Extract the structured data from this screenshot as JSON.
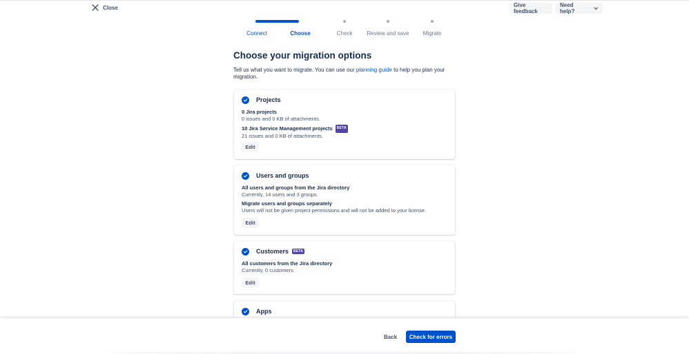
{
  "header": {
    "close_label": "Close",
    "give_feedback_label": "Give feedback",
    "need_help_label": "Need help?"
  },
  "stepper": {
    "steps": [
      {
        "label": "Connect",
        "state": "complete"
      },
      {
        "label": "Choose",
        "state": "current"
      },
      {
        "label": "Check",
        "state": "upcoming"
      },
      {
        "label": "Review and save",
        "state": "upcoming"
      },
      {
        "label": "Migrate",
        "state": "upcoming"
      }
    ]
  },
  "main": {
    "heading": "Choose your migration options",
    "intro_before": "Tell us what you want to migrate. You can use our ",
    "intro_link": "planning guide",
    "intro_after": " to help you plan your migration."
  },
  "cards": {
    "projects": {
      "title": "Projects",
      "items": [
        {
          "title": "0 Jira projects",
          "desc": "0 issues and 0 KB of attachments."
        },
        {
          "title": "10 Jira Service Management projects",
          "badge": "BETA",
          "desc": "21 issues and 0 KB of attachments."
        }
      ],
      "edit_label": "Edit"
    },
    "users": {
      "title": "Users and groups",
      "items": [
        {
          "title": "All users and groups from the Jira directory",
          "desc": "Currently, 14 users and 3 groups."
        },
        {
          "title": "Migrate users and groups separately",
          "desc": "Users will not be given project permissions and will not be added to your license."
        }
      ],
      "edit_label": "Edit"
    },
    "customers": {
      "title": "Customers",
      "badge": "BETA",
      "items": [
        {
          "title": "All customers from the Jira directory",
          "desc": "Currently, 0 customers."
        }
      ],
      "edit_label": "Edit"
    },
    "apps": {
      "title": "Apps"
    }
  },
  "footer": {
    "back_label": "Back",
    "primary_label": "Check for errors"
  },
  "colors": {
    "primary": "#0052cc",
    "text": "#172b4d",
    "subtle": "#42526e",
    "badge": "#5243aa"
  }
}
